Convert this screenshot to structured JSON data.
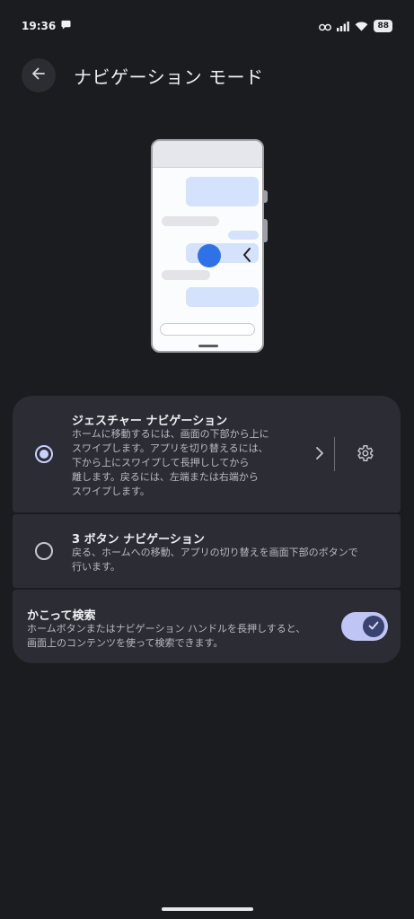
{
  "status_bar": {
    "time": "19:36",
    "battery": "88",
    "icons": [
      "chat-icon",
      "link-icon",
      "signal-icon",
      "wifi-icon",
      "battery-icon"
    ]
  },
  "header": {
    "title": "ナビゲーション モード",
    "back_icon": "arrow-left-icon"
  },
  "options": [
    {
      "title": "ジェスチャー ナビゲーション",
      "description": [
        "ホームに移動するには、画面の下部から上に",
        "スワイプします。アプリを切り替えるには、",
        "下から上にスワイプして長押ししてから",
        "離します。戻るには、左端または右端から",
        "スワイプします。"
      ],
      "selected": true
    },
    {
      "title": "3 ボタン ナビゲーション",
      "description": [
        "戻る、ホームへの移動、アプリの切り替えを画面下部のボタンで",
        "行います。"
      ],
      "selected": false
    }
  ],
  "circle_to_search": {
    "title": "かこって検索",
    "description": [
      "ホームボタンまたはナビゲーション ハンドルを長押しすると、",
      "画面上のコンテンツを使って検索できます。"
    ],
    "enabled": true
  },
  "colors": {
    "background": "#1b1c20",
    "card": "#2c2d34",
    "accent": "#c9cfff",
    "toggle_track": "#bfc5f5",
    "phone_dot": "#2f72e6"
  }
}
